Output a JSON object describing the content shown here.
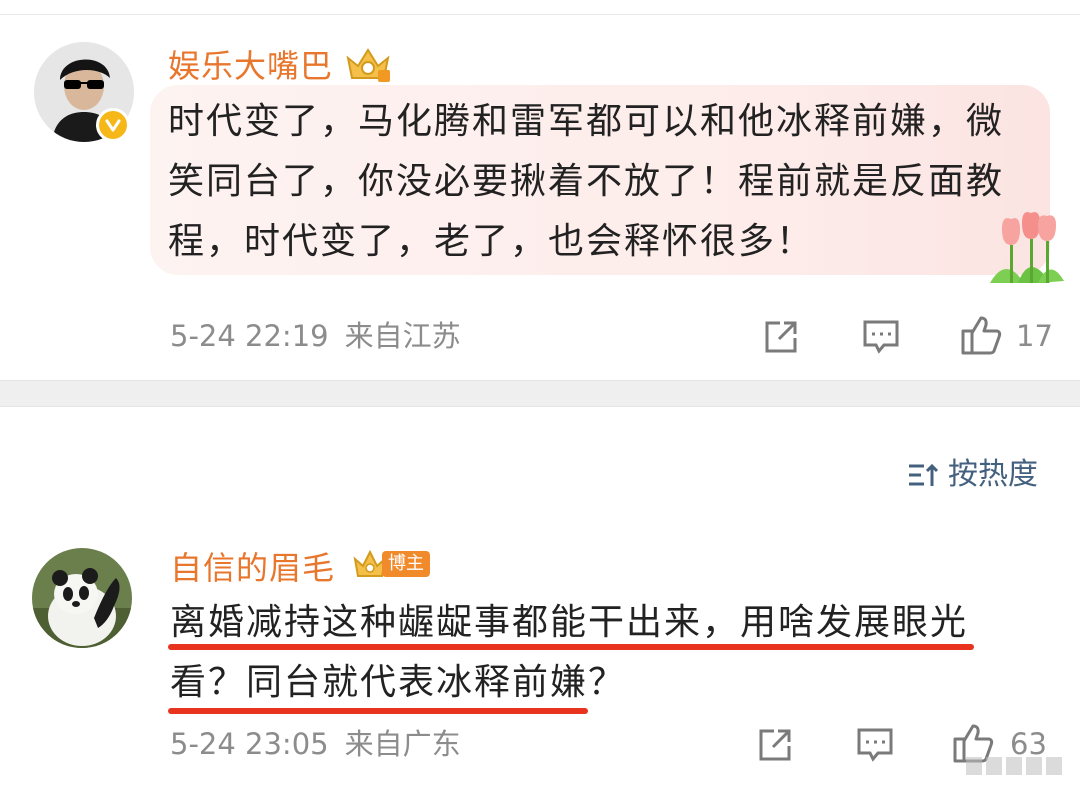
{
  "comments": [
    {
      "username": "娱乐大嘴巴",
      "text": "时代变了，马化腾和雷军都可以和他冰释前嫌，微笑同台了，你没必要揪着不放了！程前就是反面教程，时代变了，老了，也会释怀很多！",
      "time": "5-24 22:19",
      "location": "来自江苏",
      "likes": "17"
    },
    {
      "username": "自信的眉毛",
      "badge": "博主",
      "text": "离婚减持这种龌龊事都能干出来，用啥发展眼光看？同台就代表冰释前嫌？",
      "time": "5-24 23:05",
      "location": "来自广东",
      "likes": "63"
    }
  ],
  "sort": {
    "label": "按热度"
  },
  "colors": {
    "username": "#e8762d",
    "underline": "#e8331e",
    "sort": "#44607f"
  }
}
